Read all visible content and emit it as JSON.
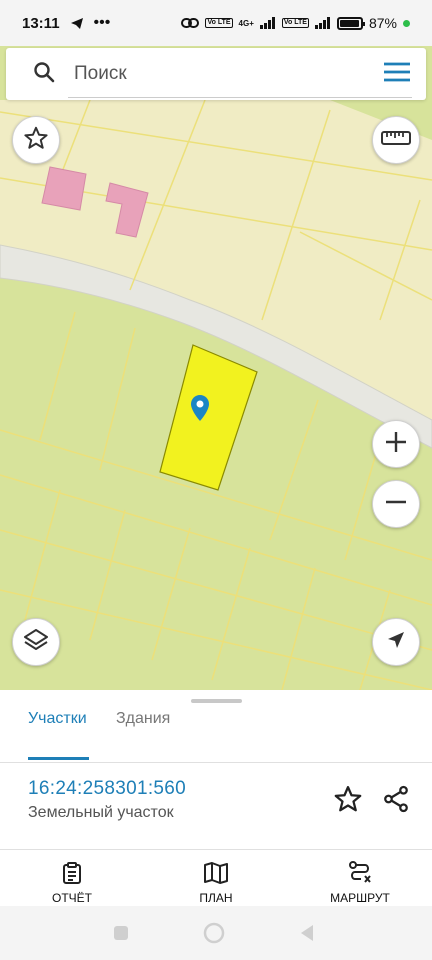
{
  "status_bar": {
    "time": "13:11",
    "signal_badge_1": "Vo LTE",
    "network_type": "4G+",
    "signal_badge_2": "Vo LTE",
    "battery": "87%",
    "battery_level": 0.87
  },
  "search": {
    "placeholder": "Поиск"
  },
  "map": {
    "colors": {
      "land": "#d7e39b",
      "residential": "#f0ecc4",
      "road": "#e7e7e1",
      "parcel_border": "#ece07a",
      "building": "#e8a2ba",
      "selected_parcel": "#f2f21f",
      "marker": "#1b86c4"
    },
    "icons": [
      "star-icon",
      "ruler-icon",
      "zoom-in-icon",
      "zoom-out-icon",
      "layers-icon",
      "navigation-arrow-icon",
      "location-pin-icon"
    ]
  },
  "tabs": [
    {
      "label": "Участки",
      "active": true
    },
    {
      "label": "Здания",
      "active": false
    }
  ],
  "parcel": {
    "cadastral_number": "16:24:258301:560",
    "type": "Земельный участок"
  },
  "bottom_nav": [
    {
      "label": "ОТЧЁТ",
      "icon": "report-clipboard-icon"
    },
    {
      "label": "ПЛАН",
      "icon": "map-plan-icon"
    },
    {
      "label": "МАРШРУТ",
      "icon": "route-icon"
    }
  ],
  "system_nav": [
    "recent-apps-icon",
    "home-icon",
    "back-icon"
  ]
}
